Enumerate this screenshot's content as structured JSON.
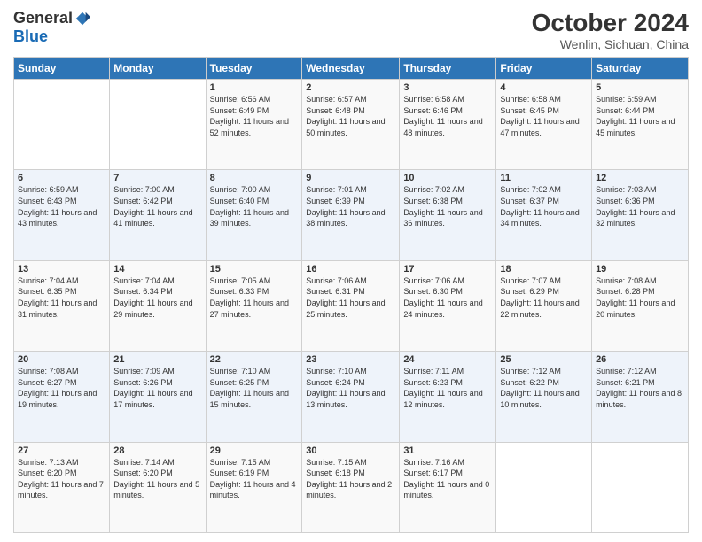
{
  "logo": {
    "general": "General",
    "blue": "Blue"
  },
  "title": "October 2024",
  "location": "Wenlin, Sichuan, China",
  "days_of_week": [
    "Sunday",
    "Monday",
    "Tuesday",
    "Wednesday",
    "Thursday",
    "Friday",
    "Saturday"
  ],
  "weeks": [
    [
      {
        "day": "",
        "sunrise": "",
        "sunset": "",
        "daylight": ""
      },
      {
        "day": "",
        "sunrise": "",
        "sunset": "",
        "daylight": ""
      },
      {
        "day": "1",
        "sunrise": "Sunrise: 6:56 AM",
        "sunset": "Sunset: 6:49 PM",
        "daylight": "Daylight: 11 hours and 52 minutes."
      },
      {
        "day": "2",
        "sunrise": "Sunrise: 6:57 AM",
        "sunset": "Sunset: 6:48 PM",
        "daylight": "Daylight: 11 hours and 50 minutes."
      },
      {
        "day": "3",
        "sunrise": "Sunrise: 6:58 AM",
        "sunset": "Sunset: 6:46 PM",
        "daylight": "Daylight: 11 hours and 48 minutes."
      },
      {
        "day": "4",
        "sunrise": "Sunrise: 6:58 AM",
        "sunset": "Sunset: 6:45 PM",
        "daylight": "Daylight: 11 hours and 47 minutes."
      },
      {
        "day": "5",
        "sunrise": "Sunrise: 6:59 AM",
        "sunset": "Sunset: 6:44 PM",
        "daylight": "Daylight: 11 hours and 45 minutes."
      }
    ],
    [
      {
        "day": "6",
        "sunrise": "Sunrise: 6:59 AM",
        "sunset": "Sunset: 6:43 PM",
        "daylight": "Daylight: 11 hours and 43 minutes."
      },
      {
        "day": "7",
        "sunrise": "Sunrise: 7:00 AM",
        "sunset": "Sunset: 6:42 PM",
        "daylight": "Daylight: 11 hours and 41 minutes."
      },
      {
        "day": "8",
        "sunrise": "Sunrise: 7:00 AM",
        "sunset": "Sunset: 6:40 PM",
        "daylight": "Daylight: 11 hours and 39 minutes."
      },
      {
        "day": "9",
        "sunrise": "Sunrise: 7:01 AM",
        "sunset": "Sunset: 6:39 PM",
        "daylight": "Daylight: 11 hours and 38 minutes."
      },
      {
        "day": "10",
        "sunrise": "Sunrise: 7:02 AM",
        "sunset": "Sunset: 6:38 PM",
        "daylight": "Daylight: 11 hours and 36 minutes."
      },
      {
        "day": "11",
        "sunrise": "Sunrise: 7:02 AM",
        "sunset": "Sunset: 6:37 PM",
        "daylight": "Daylight: 11 hours and 34 minutes."
      },
      {
        "day": "12",
        "sunrise": "Sunrise: 7:03 AM",
        "sunset": "Sunset: 6:36 PM",
        "daylight": "Daylight: 11 hours and 32 minutes."
      }
    ],
    [
      {
        "day": "13",
        "sunrise": "Sunrise: 7:04 AM",
        "sunset": "Sunset: 6:35 PM",
        "daylight": "Daylight: 11 hours and 31 minutes."
      },
      {
        "day": "14",
        "sunrise": "Sunrise: 7:04 AM",
        "sunset": "Sunset: 6:34 PM",
        "daylight": "Daylight: 11 hours and 29 minutes."
      },
      {
        "day": "15",
        "sunrise": "Sunrise: 7:05 AM",
        "sunset": "Sunset: 6:33 PM",
        "daylight": "Daylight: 11 hours and 27 minutes."
      },
      {
        "day": "16",
        "sunrise": "Sunrise: 7:06 AM",
        "sunset": "Sunset: 6:31 PM",
        "daylight": "Daylight: 11 hours and 25 minutes."
      },
      {
        "day": "17",
        "sunrise": "Sunrise: 7:06 AM",
        "sunset": "Sunset: 6:30 PM",
        "daylight": "Daylight: 11 hours and 24 minutes."
      },
      {
        "day": "18",
        "sunrise": "Sunrise: 7:07 AM",
        "sunset": "Sunset: 6:29 PM",
        "daylight": "Daylight: 11 hours and 22 minutes."
      },
      {
        "day": "19",
        "sunrise": "Sunrise: 7:08 AM",
        "sunset": "Sunset: 6:28 PM",
        "daylight": "Daylight: 11 hours and 20 minutes."
      }
    ],
    [
      {
        "day": "20",
        "sunrise": "Sunrise: 7:08 AM",
        "sunset": "Sunset: 6:27 PM",
        "daylight": "Daylight: 11 hours and 19 minutes."
      },
      {
        "day": "21",
        "sunrise": "Sunrise: 7:09 AM",
        "sunset": "Sunset: 6:26 PM",
        "daylight": "Daylight: 11 hours and 17 minutes."
      },
      {
        "day": "22",
        "sunrise": "Sunrise: 7:10 AM",
        "sunset": "Sunset: 6:25 PM",
        "daylight": "Daylight: 11 hours and 15 minutes."
      },
      {
        "day": "23",
        "sunrise": "Sunrise: 7:10 AM",
        "sunset": "Sunset: 6:24 PM",
        "daylight": "Daylight: 11 hours and 13 minutes."
      },
      {
        "day": "24",
        "sunrise": "Sunrise: 7:11 AM",
        "sunset": "Sunset: 6:23 PM",
        "daylight": "Daylight: 11 hours and 12 minutes."
      },
      {
        "day": "25",
        "sunrise": "Sunrise: 7:12 AM",
        "sunset": "Sunset: 6:22 PM",
        "daylight": "Daylight: 11 hours and 10 minutes."
      },
      {
        "day": "26",
        "sunrise": "Sunrise: 7:12 AM",
        "sunset": "Sunset: 6:21 PM",
        "daylight": "Daylight: 11 hours and 8 minutes."
      }
    ],
    [
      {
        "day": "27",
        "sunrise": "Sunrise: 7:13 AM",
        "sunset": "Sunset: 6:20 PM",
        "daylight": "Daylight: 11 hours and 7 minutes."
      },
      {
        "day": "28",
        "sunrise": "Sunrise: 7:14 AM",
        "sunset": "Sunset: 6:20 PM",
        "daylight": "Daylight: 11 hours and 5 minutes."
      },
      {
        "day": "29",
        "sunrise": "Sunrise: 7:15 AM",
        "sunset": "Sunset: 6:19 PM",
        "daylight": "Daylight: 11 hours and 4 minutes."
      },
      {
        "day": "30",
        "sunrise": "Sunrise: 7:15 AM",
        "sunset": "Sunset: 6:18 PM",
        "daylight": "Daylight: 11 hours and 2 minutes."
      },
      {
        "day": "31",
        "sunrise": "Sunrise: 7:16 AM",
        "sunset": "Sunset: 6:17 PM",
        "daylight": "Daylight: 11 hours and 0 minutes."
      },
      {
        "day": "",
        "sunrise": "",
        "sunset": "",
        "daylight": ""
      },
      {
        "day": "",
        "sunrise": "",
        "sunset": "",
        "daylight": ""
      }
    ]
  ]
}
